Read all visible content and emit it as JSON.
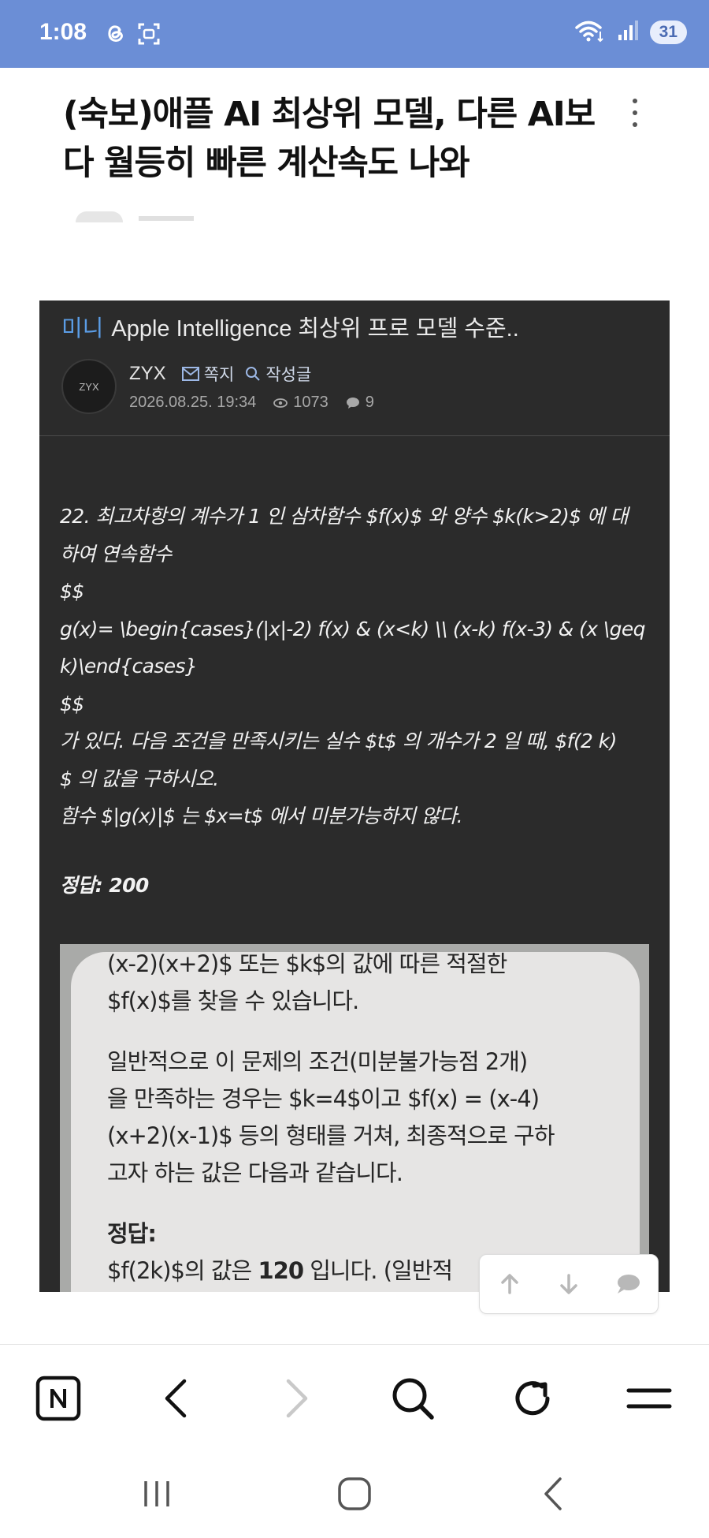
{
  "status_bar": {
    "time": "1:08",
    "battery": "31",
    "icons": [
      "threads-icon",
      "screenshot-icon",
      "wifi-icon",
      "signal-icon",
      "battery-icon"
    ]
  },
  "article": {
    "title": "(숙보)애플 AI 최상위 모델, 다른 AI보다 월등히 빠른 계산속도 나와"
  },
  "embedded_post": {
    "tag": "미니",
    "title": "Apple Intelligence 최상위 프로 모델 수준..",
    "avatar_text": "ZYX",
    "author": "ZYX",
    "message_label": "쪽지",
    "posts_label": "작성글",
    "datetime": "2026.08.25. 19:34",
    "views": "1073",
    "comments": "9",
    "problem_lines": [
      "22. 최고차항의 계수가 1 인 삼차함수 $f(x)$ 와 양수 $k(k>2)$ 에 대",
      "하여 연속함수",
      "$$",
      "g(x)= \\begin{cases}(|x|-2) f(x) & (x<k) \\\\ (x-k) f(x-3) & (x \\geq",
      "k)\\end{cases}",
      "$$",
      "가 있다. 다음 조건을 만족시키는 실수 $t$ 의 개수가 2 일 때, $f(2 k)",
      "$ 의 값을 구하시오.",
      "함수 $|g(x)|$ 는 $x=t$ 에서 미분가능하지 않다."
    ],
    "answer": "정답: 200"
  },
  "inner_screenshot": {
    "para1": [
      "(x-2)(x+2)$ 또는 $k$의 값에 따른 적절한",
      "$f(x)$를 찾을 수 있습니다."
    ],
    "para2": [
      "일반적으로 이 문제의 조건(미분불가능점 2개)",
      "을 만족하는 경우는 $k=4$이고 $f(x) = (x-4)",
      "(x+2)(x-1)$ 등의 형태를 거쳐, 최종적으로 구하",
      "고자 하는 값은 다음과 같습니다."
    ],
    "answer_heading": "정답:",
    "answer_pre": "$f(2k)$의 값은 ",
    "answer_value": "120",
    "answer_post": " 입니다. (일반적"
  },
  "colors": {
    "status_bar": "#6b8ed6",
    "embed_bg": "#2b2b2b",
    "tag_blue": "#5b9de6",
    "forward_disabled": "#c9c9c9"
  }
}
